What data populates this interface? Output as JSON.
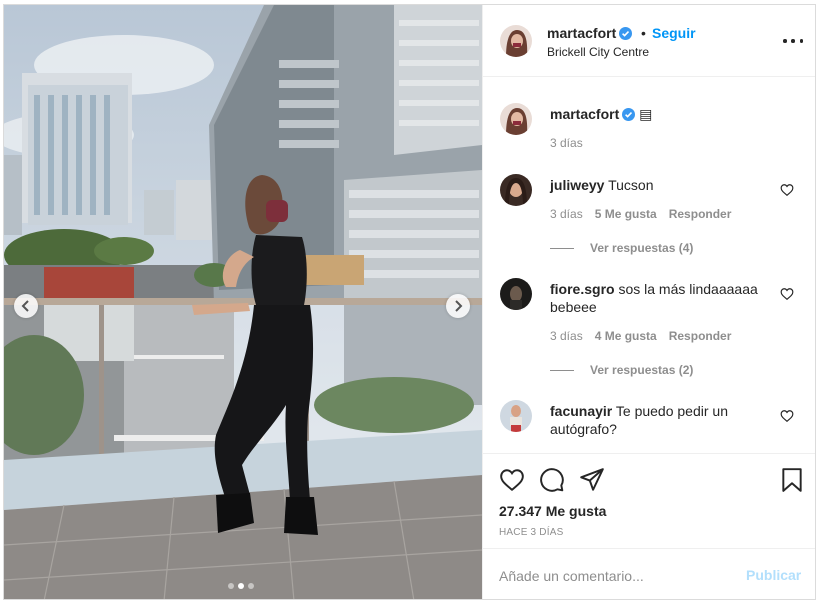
{
  "post": {
    "username": "martacfort",
    "separator": "•",
    "follow_label": "Seguir",
    "location": "Brickell City Centre",
    "more_icon": "more-horizontal-icon",
    "caption": {
      "username": "martacfort",
      "emoji": "▤",
      "time": "3 días"
    }
  },
  "comments": [
    {
      "username": "juliweyy",
      "text": "Tucson",
      "time": "3 días",
      "likes": "5 Me gusta",
      "reply_label": "Responder",
      "view_replies": "Ver respuestas (4)"
    },
    {
      "username": "fiore.sgro",
      "text": "sos la más lindaaaaaa bebeee",
      "time": "3 días",
      "likes": "4 Me gusta",
      "reply_label": "Responder",
      "view_replies": "Ver respuestas (2)"
    },
    {
      "username": "facunayir",
      "text": "Te puedo pedir un autógrafo?"
    }
  ],
  "actions": {
    "like_icon": "heart-icon",
    "comment_icon": "comment-icon",
    "share_icon": "share-icon",
    "save_icon": "bookmark-icon",
    "likes_count": "27.347 Me gusta",
    "posted_ago": "HACE 3 DÍAS"
  },
  "composer": {
    "placeholder": "Añade un comentario...",
    "publish_label": "Publicar"
  },
  "carousel": {
    "total": 3,
    "active_index": 1
  },
  "colors": {
    "accent": "#0095f6",
    "publish_disabled": "#b2dffc",
    "text": "#262626",
    "muted": "#8e8e8e",
    "border": "#efefef",
    "verified": "#3897f0"
  }
}
